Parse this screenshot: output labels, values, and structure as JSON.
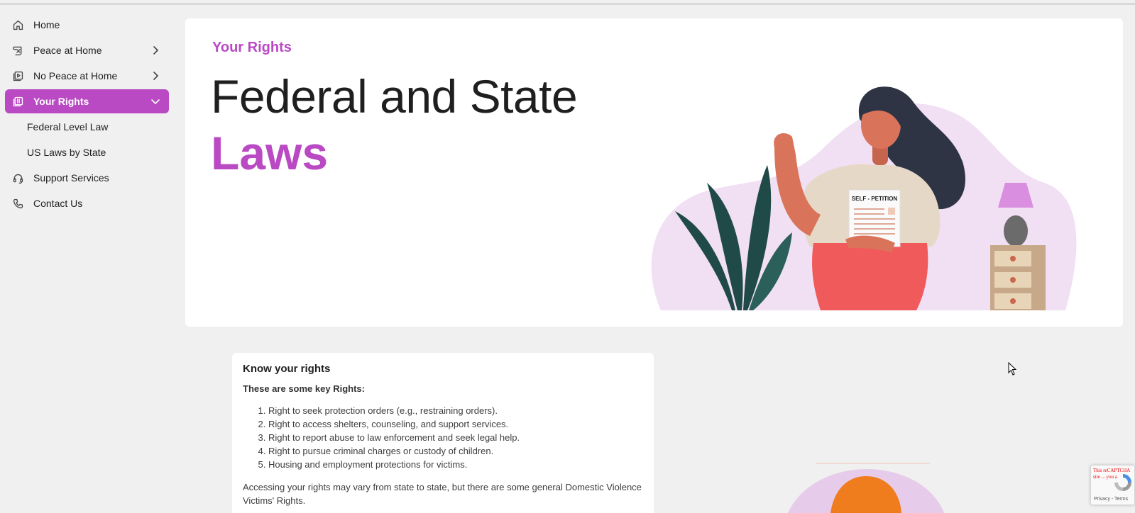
{
  "sidebar": {
    "items": [
      {
        "label": "Home",
        "icon": "home-icon"
      },
      {
        "label": "Peace at Home",
        "icon": "scroll-icon",
        "expandable": true
      },
      {
        "label": "No Peace at Home",
        "icon": "video-library-icon",
        "expandable": true
      },
      {
        "label": "Your Rights",
        "icon": "book-icon",
        "expanded": true,
        "active": true
      },
      {
        "label": "Support Services",
        "icon": "headset-icon"
      },
      {
        "label": "Contact Us",
        "icon": "phone-icon"
      }
    ],
    "subitems": [
      {
        "label": "Federal Level Law"
      },
      {
        "label": "US Laws by State"
      }
    ]
  },
  "hero": {
    "eyebrow": "Your Rights",
    "title_line1": "Federal and State",
    "title_line2": "Laws",
    "document_label": "SELF - PETITION"
  },
  "rights_card": {
    "title": "Know your rights",
    "subtitle": "These are some key Rights:",
    "items": [
      "Right to seek protection orders (e.g., restraining orders).",
      "Right to access shelters, counseling, and support services.",
      "Right to report abuse to law enforcement and seek legal help.",
      "Right to pursue criminal charges or custody of children.",
      "Housing and employment protections for victims."
    ],
    "paragraph": "Accessing your rights may vary from state to state, but there are some general Domestic Violence Victims' Rights."
  },
  "recaptcha": {
    "warning": "This reCAPTCHA site ... you a",
    "terms": "Privacy - Terms"
  },
  "colors": {
    "accent": "#b94ac3",
    "background": "#f0f0f0",
    "text": "#1f1f1f"
  }
}
